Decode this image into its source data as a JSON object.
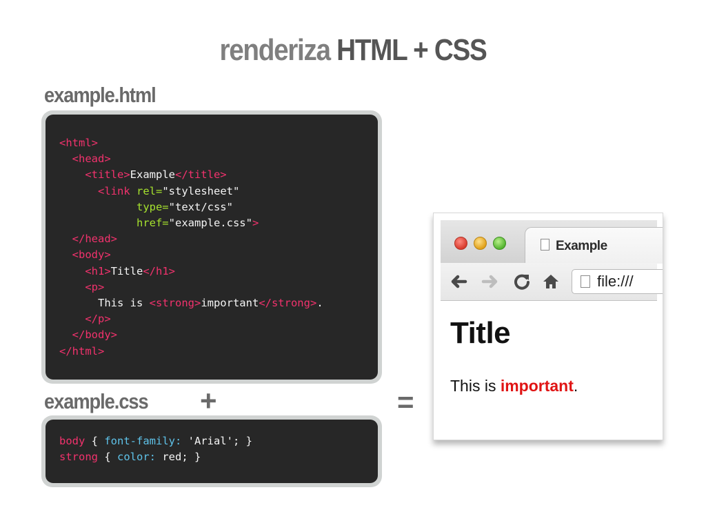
{
  "slide": {
    "title_part1": "renderiza",
    "title_part2": "HTML + CSS",
    "html_file_label": "example.html",
    "css_file_label": "example.css",
    "plus": "+",
    "equals": "="
  },
  "html_code": {
    "l1_tag": "<html>",
    "l2_tag": "<head>",
    "l3_open": "<title>",
    "l3_text": "Example",
    "l3_close": "</title>",
    "l4_tag": "<link",
    "l4_attr": "rel=",
    "l4_val": "\"stylesheet\"",
    "l5_attr": "type=",
    "l5_val": "\"text/css\"",
    "l6_attr": "href=",
    "l6_val": "\"example.css\"",
    "l6_close": ">",
    "l7_tag": "</head>",
    "l8_tag": "<body>",
    "l9_open": "<h1>",
    "l9_text": "Title",
    "l9_close": "</h1>",
    "l10_tag": "<p>",
    "l11_text1": "This is ",
    "l11_open": "<strong>",
    "l11_text2": "important",
    "l11_close": "</strong>",
    "l11_text3": ".",
    "l12_tag": "</p>",
    "l13_tag": "</body>",
    "l14_tag": "</html>"
  },
  "css_code": {
    "r1_selector": "body",
    "r1_open": " { ",
    "r1_prop": "font-family:",
    "r1_val": " 'Arial'; }",
    "r2_selector": "strong",
    "r2_open": " { ",
    "r2_prop": "color:",
    "r2_val": " red; }"
  },
  "browser": {
    "tab_title": "Example",
    "url": "file:///",
    "page_heading": "Title",
    "page_text_before": "This is ",
    "page_strong": "important",
    "page_text_after": "."
  },
  "colors": {
    "code_bg": "#272727",
    "code_frame": "#d0d3d2",
    "tag": "#f2326d",
    "attr": "#a6e22e",
    "prop": "#5fc3ea",
    "strong_red": "#e01414"
  },
  "icons": [
    "back-arrow-icon",
    "forward-arrow-icon",
    "reload-icon",
    "home-icon",
    "page-icon"
  ]
}
